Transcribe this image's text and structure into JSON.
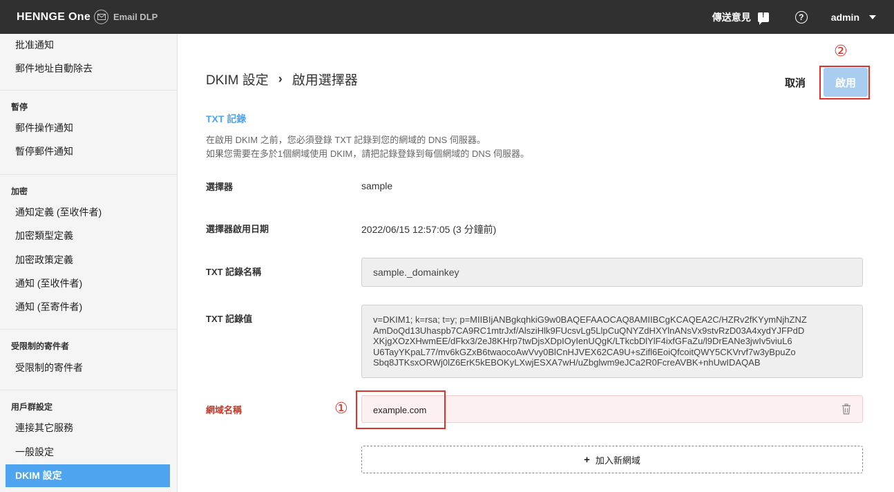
{
  "topbar": {
    "logo": "HENNGE One",
    "product": "Email DLP",
    "feedback": "傳送意見",
    "help": "?",
    "user": "admin"
  },
  "sidebar": {
    "items_top": [
      "批准通知",
      "郵件地址自動除去"
    ],
    "sections": [
      {
        "header": "暫停",
        "items": [
          "郵件操作通知",
          "暫停郵件通知"
        ]
      },
      {
        "header": "加密",
        "items": [
          "通知定義 (至收件者)",
          "加密類型定義",
          "加密政策定義",
          "通知 (至收件者)",
          "通知 (至寄件者)"
        ]
      },
      {
        "header": "受限制的寄件者",
        "items": [
          "受限制的寄件者"
        ]
      },
      {
        "header": "用戶群設定",
        "items": [
          "連接其它服務",
          "一般設定",
          "DKIM 設定"
        ]
      }
    ],
    "active": "DKIM 設定"
  },
  "breadcrumb": {
    "parent": "DKIM 設定",
    "separator": "›",
    "current": "啟用選擇器"
  },
  "actions": {
    "cancel": "取消",
    "enable": "啟用"
  },
  "markers": {
    "one": "①",
    "two": "②"
  },
  "txt": {
    "title": "TXT 記錄",
    "desc1": "在啟用 DKIM 之前，您必須登錄 TXT 記錄到您的網域的 DNS 伺服器。",
    "desc2": "如果您需要在多於1個網域使用 DKIM，請把記錄登錄到每個網域的 DNS 伺服器。"
  },
  "fields": {
    "selector_label": "選擇器",
    "selector_value": "sample",
    "date_label": "選擇器啟用日期",
    "date_value": "2022/06/15 12:57:05 (3 分鐘前)",
    "txt_name_label": "TXT 記錄名稱",
    "txt_name_value": "sample._domainkey",
    "txt_value_label": "TXT 記錄值",
    "txt_value_lines": [
      "v=DKIM1; k=rsa; t=y; p=MIIBIjANBgkqhkiG9w0BAQEFAAOCAQ8AMIIBCgKCAQEA2C/HZRv2fKYymNjhZNZ",
      "AmDoQd13Uhaspb7CA9RC1mtrJxf/AlsziHlk9FUcsvLg5LlpCuQNYZdHXYlnANsVx9stvRzD03A4xydYJFPdD",
      "XKjgXOzXHwmEE/dFkx3/2eJ8KHrp7twDjsXDpIOyIenUQgK/LTkcbDlYlF4ixfGFaZu/l9DrEANe3jwIv5viuL6",
      "U6TayYKpaL77/mv6kGZxB6twaocoAwVvy0BlCnHJVEX62CA9U+sZifl6EoiQfcoitQWY5CKVrvf7w3yBpuZo",
      "Sbq8JTKsxORWj0lZ6ErK5kEBOKyLXwjESXA7wH/uZbglwm9eJCa2R0FcreAVBK+nhUwIDAQAB"
    ],
    "domain_label": "網域名稱",
    "domain_value": "example.com",
    "add_domain": "加入新網域",
    "add_plus": "+"
  }
}
